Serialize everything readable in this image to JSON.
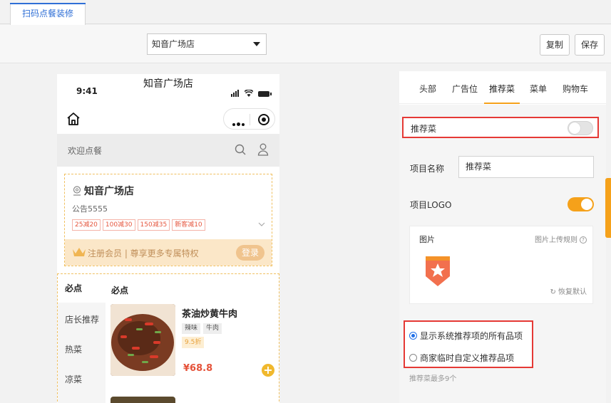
{
  "tabs": [
    "扫码点餐装修"
  ],
  "toolbar": {
    "store_select": "知音广场店",
    "copy_label": "复制",
    "save_label": "保存"
  },
  "phone": {
    "time": "9:41",
    "title": "知音广场店",
    "welcome": "欢迎点餐",
    "store_name": "知音广场店",
    "notice": "公告5555",
    "coupons": [
      "25减20",
      "100减30",
      "150减35",
      "新客减10"
    ],
    "member_text": "注册会员 | 尊享更多专属特权",
    "login_label": "登录",
    "categories": [
      "必点",
      "店长推荐",
      "热菜",
      "凉菜"
    ],
    "section_title": "必点",
    "dish": {
      "name": "茶油炒黄牛肉",
      "tags": [
        "辣味",
        "牛肉"
      ],
      "discount": "9.5折",
      "price": "¥68.8"
    }
  },
  "panel": {
    "tabs": [
      "头部",
      "广告位",
      "推荐菜",
      "菜单",
      "购物车"
    ],
    "active_tab": "推荐菜",
    "recommend_label": "推荐菜",
    "recommend_enabled": false,
    "item_name_label": "项目名称",
    "item_name_value": "推荐菜",
    "item_logo_label": "项目LOGO",
    "item_logo_enabled": true,
    "image_label": "图片",
    "upload_rule": "图片上传规则",
    "restore_label": "恢复默认",
    "radio_options": [
      "显示系统推荐项的所有品项",
      "商家临时自定义推荐品项"
    ],
    "radio_selected": 0,
    "hint": "推荐菜最多9个"
  },
  "colors": {
    "accent": "#f5a11a",
    "tab_blue": "#2f6fd6",
    "highlight": "#e53935",
    "price": "#e55239"
  }
}
